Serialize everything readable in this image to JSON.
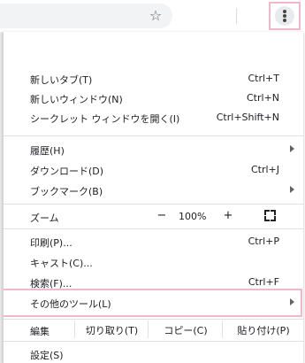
{
  "toolbar": {
    "star_icon": "bookmark-star-icon",
    "menu_icon": "three-dots-vertical-icon"
  },
  "menu": {
    "new_tab": {
      "label": "新しいタブ(T)",
      "shortcut": "Ctrl+T"
    },
    "new_window": {
      "label": "新しいウィンドウ(N)",
      "shortcut": "Ctrl+N"
    },
    "incognito": {
      "label": "シークレット ウィンドウを開く(I)",
      "shortcut": "Ctrl+Shift+N"
    },
    "history": {
      "label": "履歴(H)"
    },
    "downloads": {
      "label": "ダウンロード(D)",
      "shortcut": "Ctrl+J"
    },
    "bookmarks": {
      "label": "ブックマーク(B)"
    },
    "zoom": {
      "label": "ズーム",
      "minus": "−",
      "value": "100%",
      "plus": "+"
    },
    "print": {
      "label": "印刷(P)...",
      "shortcut": "Ctrl+P"
    },
    "cast": {
      "label": "キャスト(C)..."
    },
    "find": {
      "label": "検索(F)...",
      "shortcut": "Ctrl+F"
    },
    "more_tools": {
      "label": "その他のツール(L)"
    },
    "edit": {
      "label": "編集",
      "cut": "切り取り(T)",
      "copy": "コピー(C)",
      "paste": "貼り付け(P)"
    },
    "settings": {
      "label": "設定(S)"
    }
  },
  "colors": {
    "highlight": "#f3b6cd",
    "text": "#202124",
    "separator": "#e0e0e0"
  }
}
